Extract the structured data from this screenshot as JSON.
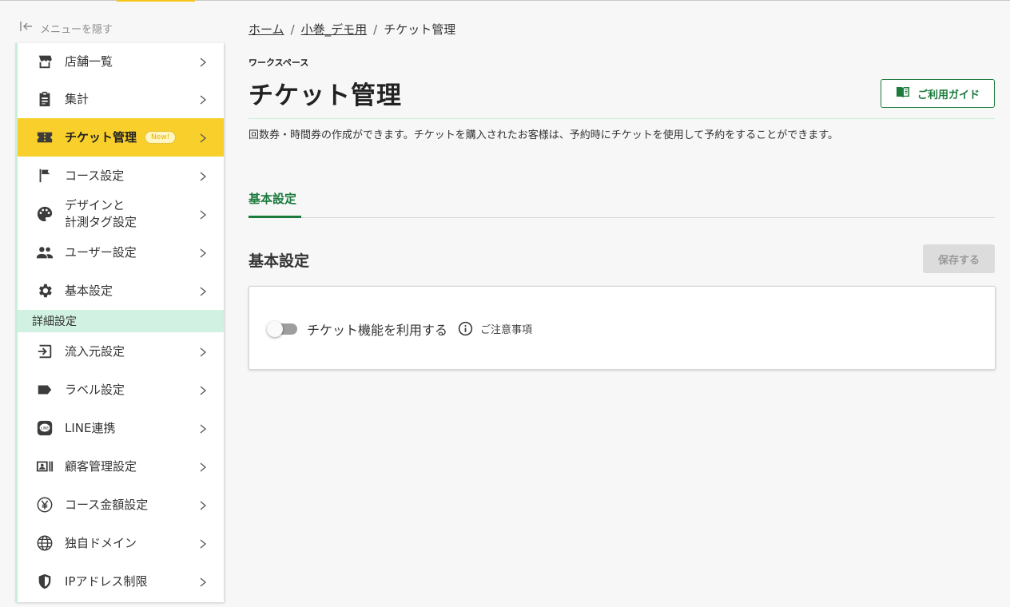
{
  "sidebar": {
    "hide_menu_label": "メニューを隠す",
    "items": [
      {
        "label": "店舗一覧",
        "icon": "store-icon"
      },
      {
        "label": "集計",
        "icon": "clipboard-icon"
      },
      {
        "label": "チケット管理",
        "icon": "ticket-icon",
        "badge": "New!",
        "active": true
      },
      {
        "label": "コース設定",
        "icon": "flag-icon"
      },
      {
        "label": "デザインと\n計測タグ設定",
        "icon": "palette-icon"
      },
      {
        "label": "ユーザー設定",
        "icon": "users-icon"
      },
      {
        "label": "基本設定",
        "icon": "gear-icon"
      }
    ],
    "section_header": "詳細設定",
    "detail_items": [
      {
        "label": "流入元設定",
        "icon": "login-arrow-icon"
      },
      {
        "label": "ラベル設定",
        "icon": "label-icon"
      },
      {
        "label": "LINE連携",
        "icon": "line-icon"
      },
      {
        "label": "顧客管理設定",
        "icon": "contact-card-icon"
      },
      {
        "label": "コース金額設定",
        "icon": "yen-icon"
      },
      {
        "label": "独自ドメイン",
        "icon": "globe-icon"
      },
      {
        "label": "IPアドレス制限",
        "icon": "shield-icon"
      }
    ],
    "chevron": ">",
    "active_color": "#f9cf2c",
    "section_color": "#d1f2e2"
  },
  "breadcrumb": {
    "home": "ホーム",
    "workspace": "小巻_デモ用",
    "current": "チケット管理",
    "separator": "/"
  },
  "header": {
    "workspace_label": "ワークスペース",
    "title": "チケット管理",
    "guide_button": "ご利用ガイド",
    "description": "回数券・時間券の作成ができます。チケットを購入されたお客様は、予約時にチケットを使用して予約をすることができます。"
  },
  "tabs": [
    {
      "label": "基本設定",
      "active": true
    }
  ],
  "basic_settings": {
    "title": "基本設定",
    "save_button": "保存する",
    "toggle_label": "チケット機能を利用する",
    "toggle_on": false,
    "notice_link": "ご注意事項"
  },
  "colors": {
    "accent_green": "#1b7a3c",
    "active_yellow": "#f9cf2c",
    "mint": "#c8efd9"
  }
}
